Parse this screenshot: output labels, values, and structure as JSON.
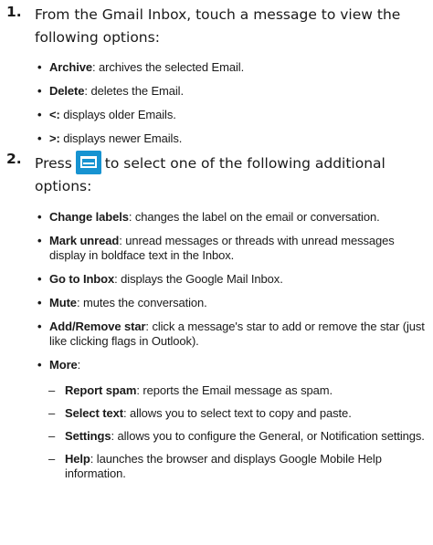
{
  "step1": {
    "number": "1.",
    "text": "From the Gmail Inbox, touch a message to view the following options:",
    "items": [
      {
        "term": "Archive",
        "desc": ": archives the selected Email."
      },
      {
        "term": "Delete",
        "desc": ": deletes the Email."
      },
      {
        "term": "<:",
        "desc": " displays older Emails."
      },
      {
        "term": ">:",
        "desc": " displays newer Emails."
      }
    ]
  },
  "step2": {
    "number": "2.",
    "text_before": "Press",
    "text_after": "to select one of the following additional options:",
    "icon": "menu-icon",
    "items": [
      {
        "term": "Change labels",
        "desc": ": changes the label on the email or conversation."
      },
      {
        "term": "Mark unread",
        "desc": ": unread messages or threads with unread messages display in boldface text in the Inbox."
      },
      {
        "term": "Go to Inbox",
        "desc": ": displays the Google Mail Inbox."
      },
      {
        "term": "Mute",
        "desc": ": mutes the conversation."
      },
      {
        "term": "Add/Remove star",
        "desc": ": click a message's star to add or remove the star (just like clicking flags in Outlook)."
      },
      {
        "term": "More",
        "desc": ":"
      }
    ],
    "more_items": [
      {
        "term": "Report spam",
        "desc": ": reports the Email message as spam."
      },
      {
        "term": "Select text",
        "desc": ": allows you to select text to copy and paste."
      },
      {
        "term": "Settings",
        "desc": ": allows you to configure the General, or Notification settings."
      },
      {
        "term": "Help",
        "desc": ": launches the browser and displays Google Mobile Help information."
      }
    ]
  }
}
